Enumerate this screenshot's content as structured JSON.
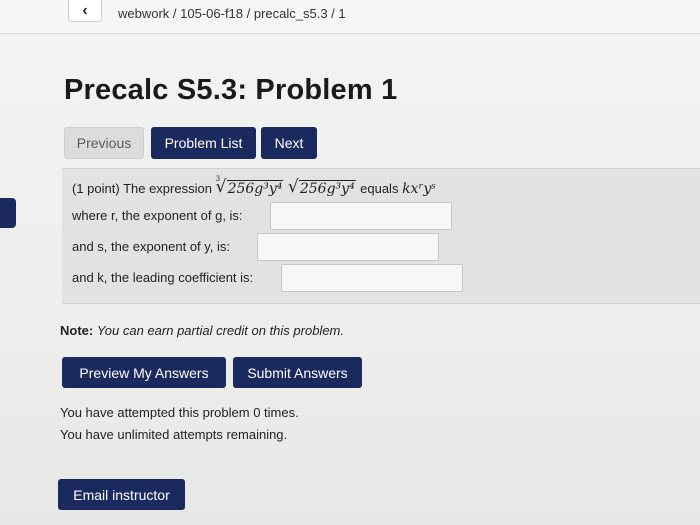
{
  "header": {
    "back_icon": "chevron-left-icon",
    "back_glyph": "‹",
    "breadcrumb": "webwork / 105-06-f18 / precalc_s5.3 / 1"
  },
  "title": "Precalc S5.3: Problem 1",
  "nav": {
    "previous": "Previous",
    "problem_list": "Problem List",
    "next": "Next"
  },
  "problem": {
    "intro": "(1 point) The expression",
    "radicand": "256g³y⁴",
    "root_index": "3",
    "equals": "equals",
    "result_expr": "kxʳyˢ",
    "q_r": "where r, the exponent of g, is:",
    "q_s": "and s, the exponent of y, is:",
    "q_k": "and k, the leading coefficient is:",
    "answer_r": "",
    "answer_s": "",
    "answer_k": ""
  },
  "note": {
    "label": "Note:",
    "text": "You can earn partial credit on this problem."
  },
  "actions": {
    "preview": "Preview My Answers",
    "submit": "Submit Answers"
  },
  "attempts": {
    "line1": "You have attempted this problem 0 times.",
    "line2": "You have unlimited attempts remaining."
  },
  "email": "Email instructor",
  "colors": {
    "primary_button": "#1a2a5e",
    "disabled_button": "#dcdcda",
    "problem_bg": "#e2e2e0"
  }
}
